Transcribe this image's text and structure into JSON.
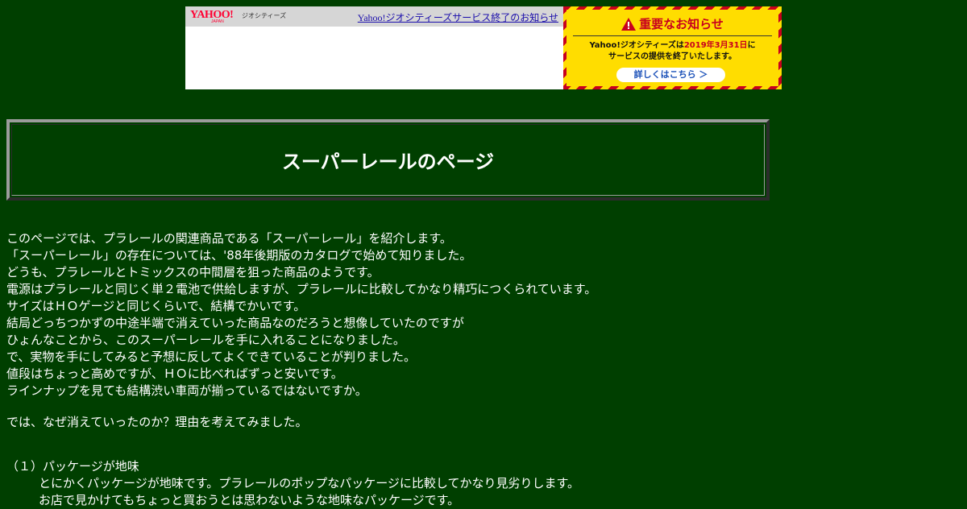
{
  "banner": {
    "logo_text": "YAHOO!",
    "logo_sub": "JAPAN",
    "logo_service": "ジオシティーズ",
    "link_text": "Yahoo!ジオシティーズサービス終了のお知らせ",
    "notice": {
      "title": "重要なお知らせ",
      "line1_prefix": "Yahoo!ジオシティーズは",
      "line1_date": "2019年3月31日",
      "line1_suffix": "に",
      "line2": "サービスの提供を終了いたします。",
      "button": "詳しくはこちら ＞"
    }
  },
  "page": {
    "title": "スーパーレールのページ"
  },
  "intro": [
    "このページでは、プラレールの関連商品である「スーパーレール」を紹介します。",
    "「スーパーレール」の存在については、'88年後期版のカタログで始めて知りました。",
    "どうも、プラレールとトミックスの中間層を狙った商品のようです。",
    "電源はプラレールと同じく単２電池で供給しますが、プラレールに比較してかなり精巧につくられています。",
    "サイズはＨＯゲージと同じくらいで、結構でかいです。",
    "結局どっちつかずの中途半端で消えていった商品なのだろうと想像していたのですが",
    "ひょんなことから、このスーパーレールを手に入れることになりました。",
    "で、実物を手にしてみると予想に反してよくできていることが判りました。",
    "値段はちょっと高めですが、ＨＯに比べればずっと安いです。",
    "ラインナップを見ても結構渋い車両が揃っているではないですか。"
  ],
  "question": "では、なぜ消えていったのか？理由を考えてみました。",
  "reason1": {
    "heading": "（１）パッケージが地味",
    "lines": [
      "とにかくパッケージが地味です。プラレールのポップなパッケージに比較してかなり見劣りします。",
      "お店で見かけてもちょっと買おうとは思わないような地味なパッケージです。"
    ]
  },
  "colors": {
    "background": "#003f00",
    "text": "#ffffff",
    "notice_yellow": "#ffdd00",
    "notice_red": "#c8001e",
    "link": "#1a0dab"
  }
}
